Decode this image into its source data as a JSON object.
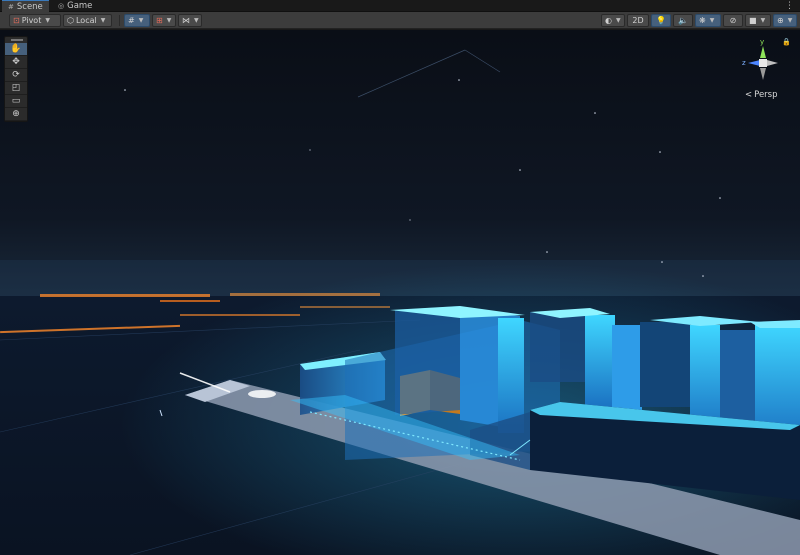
{
  "tabs": [
    {
      "label": "Scene",
      "icon": "grid-icon",
      "active": true
    },
    {
      "label": "Game",
      "icon": "gamepad-icon",
      "active": false
    }
  ],
  "toolbar": {
    "pivot_label": "Pivot",
    "local_label": "Local",
    "twod_label": "2D"
  },
  "tools": [
    {
      "name": "hand-tool",
      "glyph": "✋",
      "active": true
    },
    {
      "name": "move-tool",
      "glyph": "✥",
      "active": false
    },
    {
      "name": "rotate-tool",
      "glyph": "⟳",
      "active": false
    },
    {
      "name": "scale-tool",
      "glyph": "◰",
      "active": false
    },
    {
      "name": "rect-tool",
      "glyph": "▭",
      "active": false
    },
    {
      "name": "transform-tool",
      "glyph": "⊕",
      "active": false
    }
  ],
  "gizmo": {
    "y_label": "y",
    "z_label": "z",
    "projection_label": "Persp"
  },
  "colors": {
    "accent": "#46607c",
    "neon_blue": "#2ec8ff",
    "city_orange": "#ff8a2a",
    "sky": "#0b111a"
  }
}
